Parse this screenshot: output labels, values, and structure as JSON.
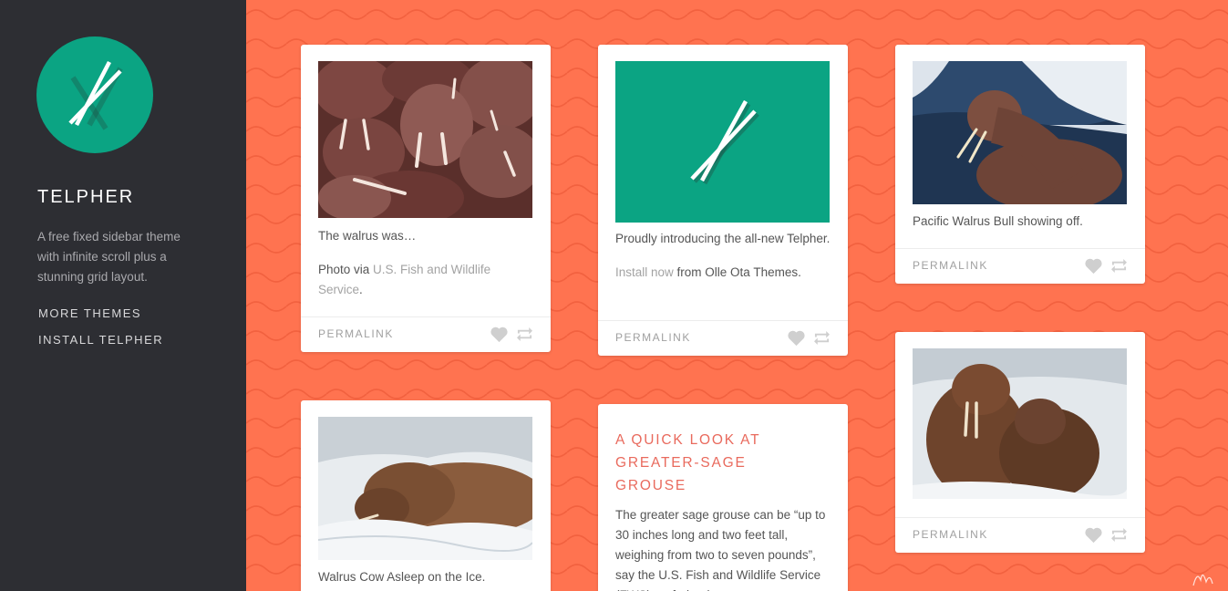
{
  "sidebar": {
    "title": "TELPHER",
    "description": "A free fixed sidebar theme with infinite scroll plus a stunning grid layout.",
    "links": [
      "MORE THEMES",
      "INSTALL TELPHER"
    ],
    "logo_color": "#0ba483"
  },
  "colors": {
    "background": "#ff7350",
    "sidebar": "#2d2e33",
    "accent_title": "#e96a5d"
  },
  "posts": [
    {
      "caption": "The walrus was…",
      "credit_prefix": "Photo via ",
      "credit_link": "U.S. Fish and Wildlife Service",
      "credit_suffix": ".",
      "permalink": "PERMALINK",
      "image": "walrus-herd-photo"
    },
    {
      "caption": "Proudly introducing the all-new Telpher.",
      "install_link": "Install now",
      "install_suffix": " from Olle Ota Themes.",
      "permalink": "PERMALINK",
      "image": "telpher-logo-banner"
    },
    {
      "caption": "Pacific Walrus Bull showing off.",
      "permalink": "PERMALINK",
      "image": "walrus-bull-swimming-photo"
    },
    {
      "caption": "Walrus Cow Asleep on the Ice.",
      "image": "walrus-cow-on-ice-photo"
    },
    {
      "title": "A QUICK LOOK AT GREATER-SAGE GROUSE",
      "body": "The greater sage grouse can be “up to 30 inches long and two feet tall, weighing from two to seven pounds”, say the U.S. Fish and Wildlife Service (FWS) - a federal"
    },
    {
      "permalink": "PERMALINK",
      "image": "two-walruses-on-ice-photo"
    }
  ]
}
